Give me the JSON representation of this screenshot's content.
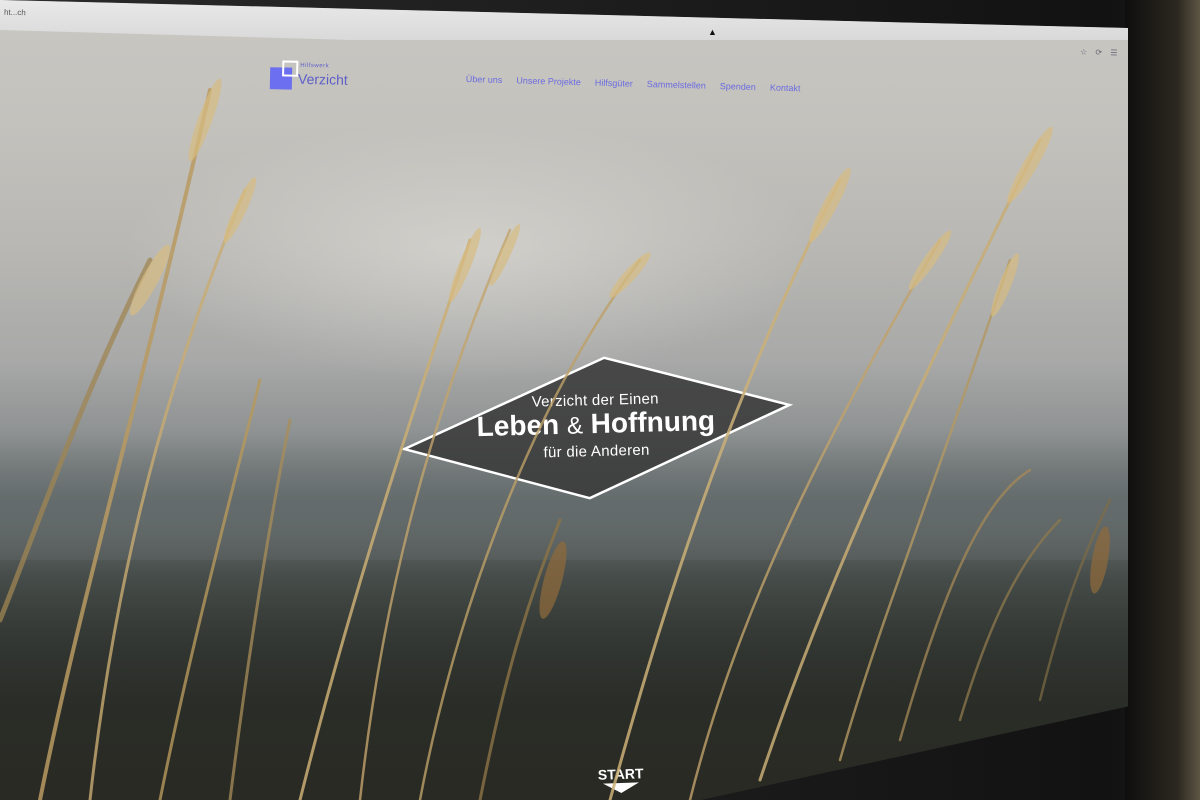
{
  "browser": {
    "address_text": "ht...ch",
    "toolbar_icons": "☆ ⟳ ☰"
  },
  "site": {
    "logo_small": "Hilfswerk",
    "logo_text": "Verzicht",
    "logo_color": "#6c6ff0"
  },
  "nav": {
    "items": [
      {
        "label": "Über uns"
      },
      {
        "label": "Unsere Projekte"
      },
      {
        "label": "Hilfsgüter"
      },
      {
        "label": "Sammelstellen"
      },
      {
        "label": "Spenden"
      },
      {
        "label": "Kontakt"
      }
    ]
  },
  "hero": {
    "line1": "Verzicht der Einen",
    "word1": "Leben",
    "amp": "&",
    "word2": "Hoffnung",
    "line3": "für die Anderen"
  },
  "start": {
    "label": "START"
  }
}
